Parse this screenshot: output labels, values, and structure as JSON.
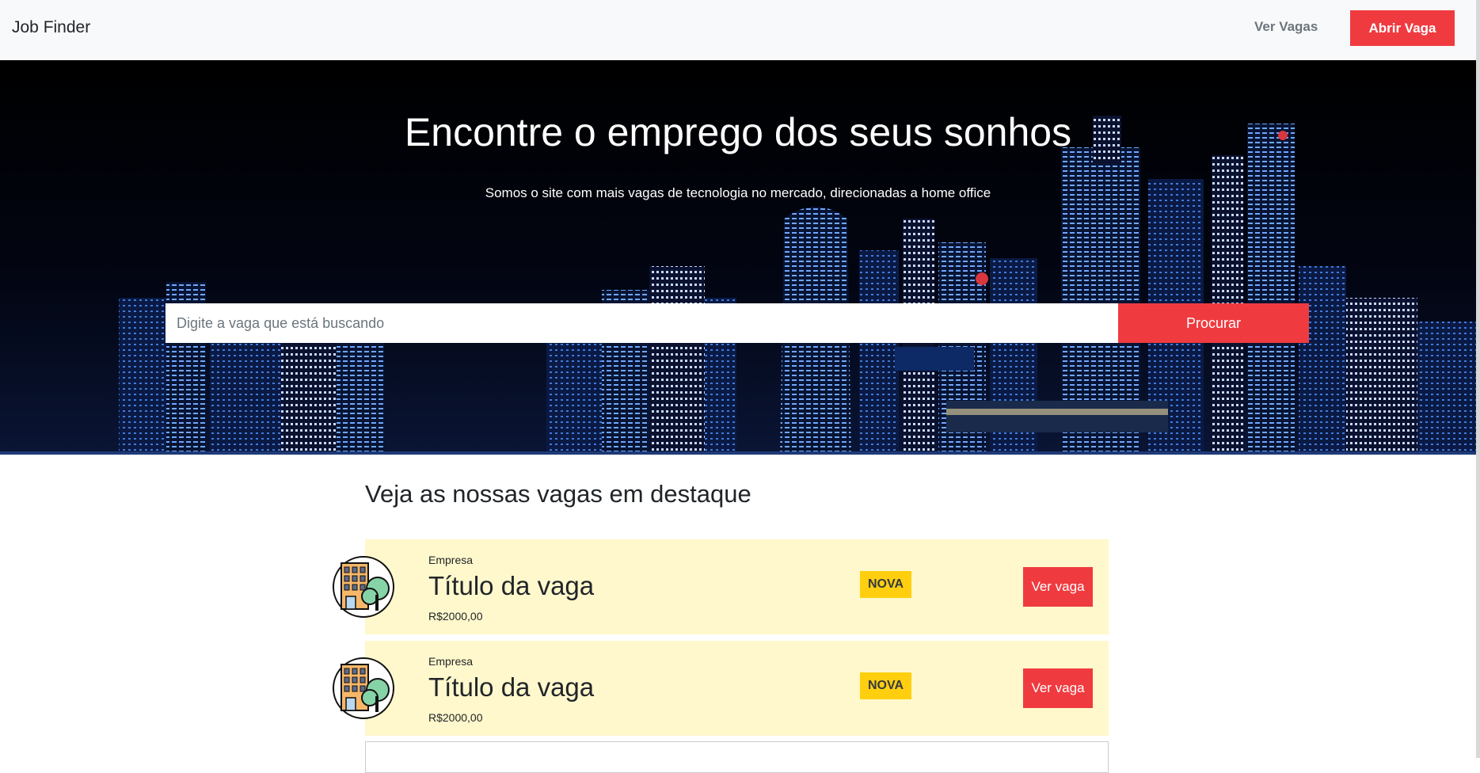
{
  "navbar": {
    "brand": "Job Finder",
    "view_jobs": "Ver Vagas",
    "open_job": "Abrir Vaga"
  },
  "hero": {
    "title": "Encontre o emprego dos seus sonhos",
    "subtitle": "Somos o site com mais vagas de tecnologia no mercado, direcionadas a home office",
    "search_placeholder": "Digite a vaga que está buscando",
    "search_button": "Procurar"
  },
  "featured": {
    "title": "Veja as nossas vagas em destaque",
    "jobs": [
      {
        "company": "Empresa",
        "title": "Título da vaga",
        "salary": "R$2000,00",
        "badge": "NOVA",
        "button": "Ver vaga"
      },
      {
        "company": "Empresa",
        "title": "Título da vaga",
        "salary": "R$2000,00",
        "badge": "NOVA",
        "button": "Ver vaga"
      }
    ]
  },
  "colors": {
    "accent": "#ef3b40",
    "badge": "#ffcf0f",
    "card_bg": "#fff8cc",
    "navbar_bg": "#f8f9fa"
  },
  "icons": [
    "building-tree-icon"
  ]
}
